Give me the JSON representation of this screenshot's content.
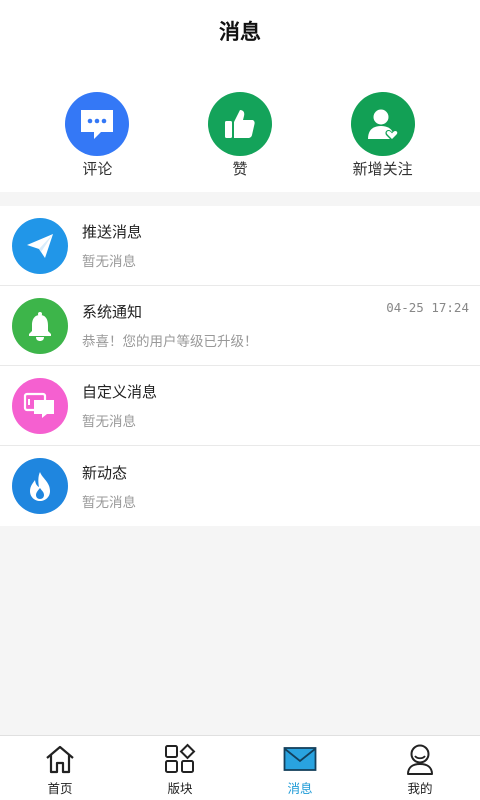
{
  "header": {
    "title": "消息"
  },
  "shortcuts": [
    {
      "label": "评论",
      "icon": "comment-icon",
      "color": "#3478f6"
    },
    {
      "label": "赞",
      "icon": "thumbs-up-icon",
      "color": "#14a35a"
    },
    {
      "label": "新增关注",
      "icon": "user-heart-icon",
      "color": "#12a055"
    }
  ],
  "messages": [
    {
      "name": "推送消息",
      "sub": "暂无消息",
      "time": "",
      "icon": "paper-plane-icon",
      "color": "#2196e8"
    },
    {
      "name": "系统通知",
      "sub": "恭喜！您的用户等级已升级！",
      "time": "04-25 17:24",
      "icon": "bell-icon",
      "color": "#3db54a"
    },
    {
      "name": "自定义消息",
      "sub": "暂无消息",
      "time": "",
      "icon": "chat-bubbles-icon",
      "color": "#f560d0"
    },
    {
      "name": "新动态",
      "sub": "暂无消息",
      "time": "",
      "icon": "flame-icon",
      "color": "#1f86df"
    }
  ],
  "tabs": [
    {
      "label": "首页",
      "icon": "home-icon",
      "active": false
    },
    {
      "label": "版块",
      "icon": "grid-icon",
      "active": false
    },
    {
      "label": "消息",
      "icon": "mail-icon",
      "active": true
    },
    {
      "label": "我的",
      "icon": "user-icon",
      "active": false
    }
  ],
  "colors": {
    "active_tab": "#1d9ad6"
  }
}
